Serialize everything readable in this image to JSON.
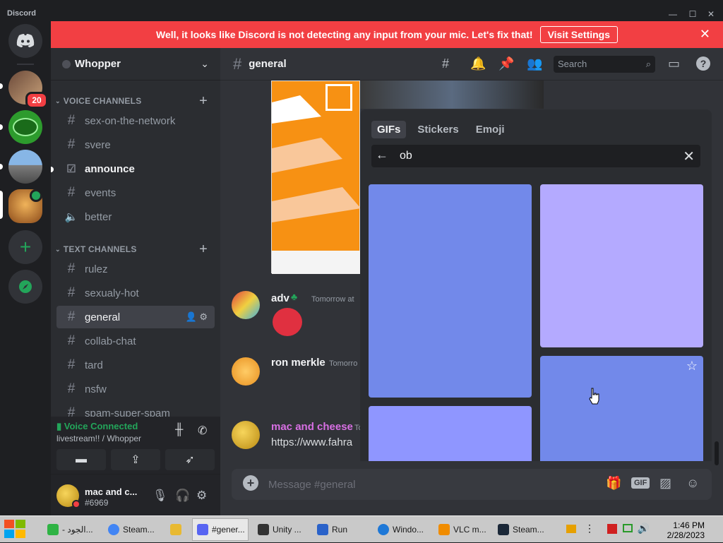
{
  "window": {
    "title": "Discord",
    "controls": [
      "—",
      "☐",
      "✕"
    ]
  },
  "banner": {
    "message": "Well, it looks like Discord is not detecting any input from your mic. Let's fix that!",
    "button_label": "Visit Settings",
    "close": "✕"
  },
  "rail": {
    "badge_count": "20"
  },
  "server": {
    "name": "Whopper"
  },
  "voice_category": {
    "label": "VOICE CHANNELS"
  },
  "voice_channels": [
    {
      "name": "sex-on-the-network"
    },
    {
      "name": "svere"
    },
    {
      "name": "announce"
    },
    {
      "name": "events"
    },
    {
      "name": "better"
    }
  ],
  "text_category": {
    "label": "TEXT CHANNELS"
  },
  "text_channels": [
    {
      "name": "rulez"
    },
    {
      "name": "sexualy-hot"
    },
    {
      "name": "general"
    },
    {
      "name": "collab-chat"
    },
    {
      "name": "tard"
    },
    {
      "name": "nsfw"
    },
    {
      "name": "spam-super-spam"
    }
  ],
  "voice_connection": {
    "status": "Voice Connected",
    "location": "livestream!! / Whopper"
  },
  "user": {
    "name": "mac and c...",
    "tag": "#6969"
  },
  "chat": {
    "channel": "general",
    "search_placeholder": "Search",
    "messages": [
      {
        "author": "adv",
        "time": "Tomorrow at",
        "text": ""
      },
      {
        "author": "ron merkle",
        "time": "Tomorro",
        "text": ""
      },
      {
        "author": "mac and cheese",
        "time": "To",
        "text": "https://www.fahra"
      }
    ],
    "composer_placeholder": "Message #general",
    "gif_label": "GIF"
  },
  "gif_picker": {
    "tabs": [
      "GIFs",
      "Stickers",
      "Emoji"
    ],
    "search_value": "ob",
    "tiles": [
      {
        "color": "#7289ea"
      },
      {
        "color": "#b4aaff"
      },
      {
        "color": "#8f96ff"
      },
      {
        "color": "#7289ea"
      }
    ]
  },
  "taskbar": {
    "tasks": [
      {
        "label": "- الجود...",
        "color": "#2fb344"
      },
      {
        "label": "Steam...",
        "color": "#4285f4"
      },
      {
        "label": "",
        "color": "#e8b931"
      },
      {
        "label": "#gener...",
        "color": "#5865f2"
      },
      {
        "label": "Unity ...",
        "color": "#333333"
      },
      {
        "label": "Run",
        "color": "#2a62c9"
      },
      {
        "label": "Windo...",
        "color": "#1e78d7"
      },
      {
        "label": "VLC m...",
        "color": "#f08c00"
      },
      {
        "label": "Steam...",
        "color": "#1b2838"
      }
    ],
    "time": "1:46 PM",
    "date": "2/28/2023"
  }
}
